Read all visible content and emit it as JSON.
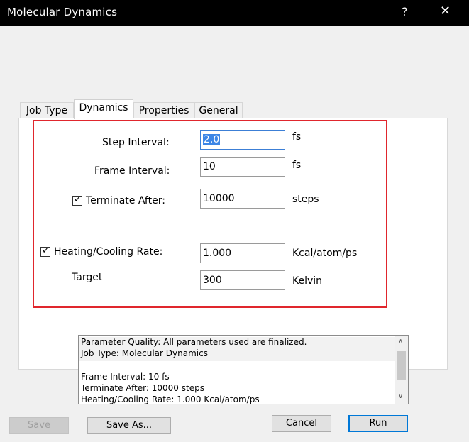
{
  "window": {
    "title": "Molecular Dynamics",
    "help": "?",
    "close": "✕"
  },
  "tabs": [
    {
      "label": "Job Type"
    },
    {
      "label": "Dynamics"
    },
    {
      "label": "Properties"
    },
    {
      "label": "General"
    }
  ],
  "dynamics": {
    "step_interval": {
      "label": "Step Interval:",
      "value": "2.0",
      "unit": "fs"
    },
    "frame_interval": {
      "label": "Frame Interval:",
      "value": "10",
      "unit": "fs"
    },
    "terminate_after": {
      "label": "Terminate After:",
      "value": "10000",
      "unit": "steps",
      "checked": true
    },
    "heating_cooling": {
      "label": "Heating/Cooling Rate:",
      "value": "1.000",
      "unit": "Kcal/atom/ps",
      "checked": true
    },
    "target": {
      "label": "Target",
      "value": "300",
      "unit": "Kelvin"
    }
  },
  "status_lines": [
    "Parameter Quality: All parameters used are finalized.",
    "Job Type: Molecular Dynamics",
    "Frame Interval: 10 fs",
    "Terminate After: 10000 steps",
    "Heating/Cooling Rate: 1.000 Kcal/atom/ps"
  ],
  "buttons": {
    "save": "Save",
    "save_as": "Save As...",
    "cancel": "Cancel",
    "run": "Run"
  },
  "colors": {
    "highlight_box": "#e0262d",
    "selection": "#3d86e6",
    "default_button_border": "#0078d7"
  }
}
